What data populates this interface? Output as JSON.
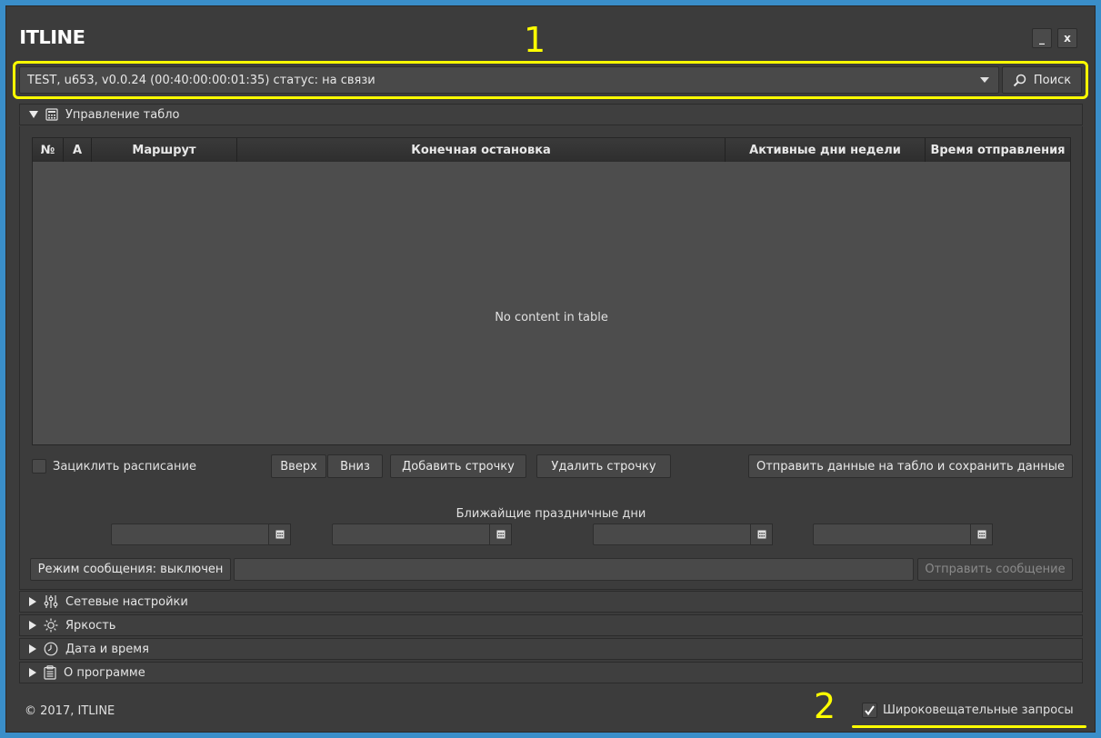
{
  "app": {
    "logo": "ITLINE",
    "minimize_label": "_",
    "close_label": "x"
  },
  "annotations": {
    "marker_1": "1",
    "marker_2": "2",
    "color": "#ffff00"
  },
  "device": {
    "selected": "TEST, u653, v0.0.24 (00:40:00:00:01:35) статус: на связи",
    "search_label": "Поиск"
  },
  "panel": {
    "title": "Управление табло",
    "table": {
      "columns": [
        "№",
        "А",
        "Маршрут",
        "Конечная остановка",
        "Активные дни недели",
        "Время отправления"
      ],
      "rows": [],
      "empty_text": "No content in table"
    },
    "loop_label": "Зациклить расписание",
    "loop_checked": false,
    "up_label": "Вверх",
    "down_label": "Вниз",
    "add_row_label": "Добавить строчку",
    "delete_row_label": "Удалить строчку",
    "send_save_label": "Отправить данные на табло и сохранить данные",
    "holidays_label": "Ближайщие праздничные дни",
    "holiday_dates": [
      "",
      "",
      "",
      ""
    ],
    "message_mode_label": "Режим сообщения: выключен",
    "message_value": "",
    "send_message_label": "Отправить сообщение"
  },
  "sections": [
    {
      "label": "Сетевые настройки",
      "icon": "sliders-icon"
    },
    {
      "label": "Яркость",
      "icon": "sun-icon"
    },
    {
      "label": "Дата и время",
      "icon": "clock-icon"
    },
    {
      "label": "О программе",
      "icon": "clipboard-icon"
    }
  ],
  "footer": {
    "copyright": "© 2017, ITLINE",
    "broadcast_label": "Широковещательные запросы",
    "broadcast_checked": true
  },
  "colors": {
    "background": "#3a8ec9",
    "window": "#3c3c3c",
    "table_body": "#4d4d4d",
    "highlight": "#ffff00"
  }
}
